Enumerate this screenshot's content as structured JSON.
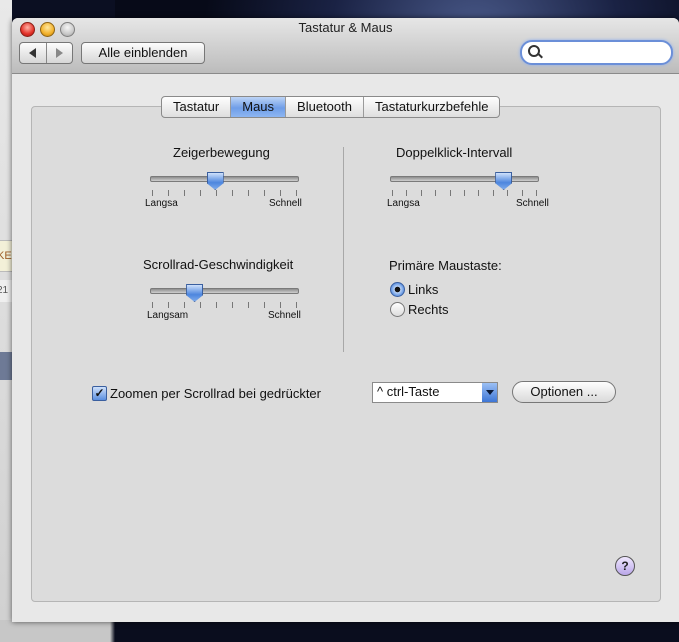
{
  "window": {
    "title": "Tastatur & Maus"
  },
  "toolbar": {
    "show_all_label": "Alle einblenden",
    "search_placeholder": ""
  },
  "tabs": [
    {
      "label": "Tastatur",
      "selected": false
    },
    {
      "label": "Maus",
      "selected": true
    },
    {
      "label": "Bluetooth",
      "selected": false
    },
    {
      "label": "Tastaturkurzbefehle",
      "selected": false
    }
  ],
  "pointer_speed": {
    "title": "Zeigerbewegung",
    "min_label": "Langsa",
    "max_label": "Schnell",
    "level": 0.44
  },
  "double_click": {
    "title": "Doppelklick-Intervall",
    "min_label": "Langsa",
    "max_label": "Schnell",
    "level": 0.77
  },
  "scroll_speed": {
    "title": "Scrollrad-Geschwindigkeit",
    "min_label": "Langsam",
    "max_label": "Schnell",
    "level": 0.3
  },
  "primary_button": {
    "title": "Primäre Maustaste:",
    "options": [
      {
        "label": "Links",
        "checked": true
      },
      {
        "label": "Rechts",
        "checked": false
      }
    ]
  },
  "zoom": {
    "checkbox_label": "Zoomen per Scrollrad bei gedrückter",
    "checked": true,
    "modifier_value": "^ ctrl-Taste",
    "options_label": "Optionen ..."
  },
  "help": {
    "label": "?"
  },
  "background": {
    "fragment_1": "KE",
    "fragment_2": "21"
  },
  "colors": {
    "accent": "#4d86de",
    "search_focus": "#6b8fd8"
  }
}
